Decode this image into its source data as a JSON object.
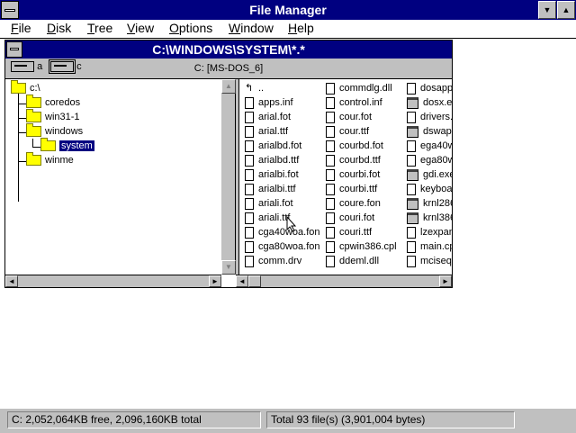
{
  "app": {
    "title": "File Manager",
    "restore_glyph": "▲",
    "minimize_glyph": "▼"
  },
  "menu": [
    {
      "key": "F",
      "rest": "ile"
    },
    {
      "key": "D",
      "rest": "isk"
    },
    {
      "key": "T",
      "rest": "ree"
    },
    {
      "key": "V",
      "rest": "iew"
    },
    {
      "key": "O",
      "rest": "ptions"
    },
    {
      "key": "W",
      "rest": "indow"
    },
    {
      "key": "H",
      "rest": "elp"
    }
  ],
  "window": {
    "title": "C:\\WINDOWS\\SYSTEM\\*.*",
    "volume_label": "C: [MS-DOS_6]"
  },
  "drives": [
    {
      "letter": "a",
      "selected": false
    },
    {
      "letter": "c",
      "selected": true
    }
  ],
  "tree": {
    "root": "c:\\",
    "nodes": [
      {
        "label": "coredos"
      },
      {
        "label": "win31-1"
      },
      {
        "label": "windows"
      },
      {
        "label": "system",
        "selected": true
      },
      {
        "label": "winme"
      }
    ]
  },
  "files": {
    "columns": [
      [
        "..",
        "apps.inf",
        "arial.fot",
        "arial.ttf",
        "arialbd.fot",
        "arialbd.ttf",
        "arialbi.fot",
        "arialbi.ttf",
        "ariali.fot",
        "ariali.ttf",
        "cga40woa.fon",
        "cga80woa.fon",
        "comm.drv"
      ],
      [
        "commdlg.dll",
        "control.inf",
        "cour.fot",
        "cour.ttf",
        "courbd.fot",
        "courbd.ttf",
        "courbi.fot",
        "courbi.ttf",
        "coure.fon",
        "couri.fot",
        "couri.ttf",
        "cpwin386.cpl",
        "ddeml.dll"
      ],
      [
        "dosapp.",
        "dosx.exe",
        "drivers.",
        "dswap.e",
        "ega40w",
        "ega80w",
        "gdi.exe",
        "keyboar",
        "krnl286.",
        "krnl386.",
        "lzexpand",
        "main.cp",
        "mciseq."
      ]
    ],
    "exe_files": [
      "dosx.exe",
      "dswap.e",
      "gdi.exe",
      "krnl286.",
      "krnl386."
    ]
  },
  "status": {
    "disk": "C: 2,052,064KB free,  2,096,160KB total",
    "total": "Total 93 file(s) (3,901,004 bytes)"
  },
  "scroll": {
    "up": "▲",
    "down": "▼",
    "left": "◄",
    "right": "►"
  }
}
